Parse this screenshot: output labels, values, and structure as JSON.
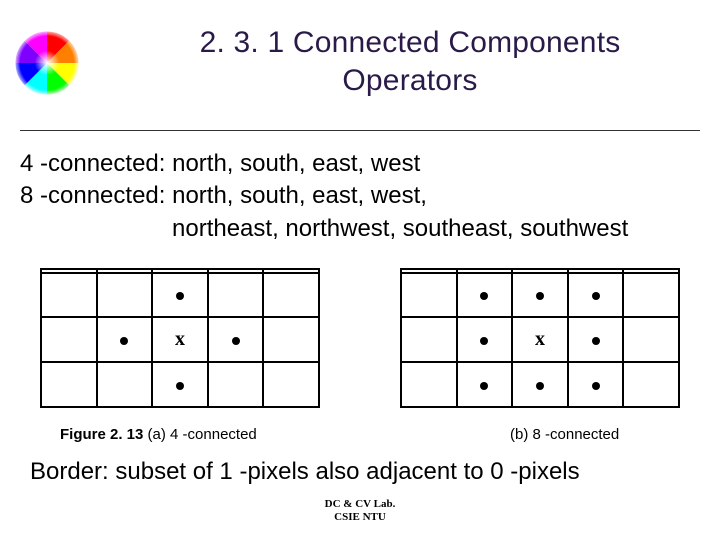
{
  "title": "2. 3. 1 Connected Components Operators",
  "body": {
    "line1": "4 -connected: north, south, east, west",
    "line2": "8 -connected: north, south, east, west,",
    "line3": "northeast, northwest, southeast, southwest"
  },
  "figures": {
    "grid_a": {
      "rows": 4,
      "cols": 5,
      "cells": {
        "1,2": "dot",
        "2,1": "dot",
        "2,2": "x",
        "2,3": "dot",
        "3,2": "dot"
      }
    },
    "grid_b": {
      "rows": 4,
      "cols": 5,
      "cells": {
        "1,1": "dot",
        "1,2": "dot",
        "1,3": "dot",
        "2,1": "dot",
        "2,2": "x",
        "2,3": "dot",
        "3,1": "dot",
        "3,2": "dot",
        "3,3": "dot"
      }
    },
    "caption_a_prefix": "Figure 2. 13 ",
    "caption_a_label": "(a) 4 -connected",
    "caption_b_label": "(b) 8 -connected"
  },
  "border_text": "Border: subset of 1 -pixels also adjacent to 0 -pixels",
  "footer": {
    "line1": "DC & CV Lab.",
    "line2": "CSIE NTU"
  },
  "icon_name": "color-wheel-icon"
}
